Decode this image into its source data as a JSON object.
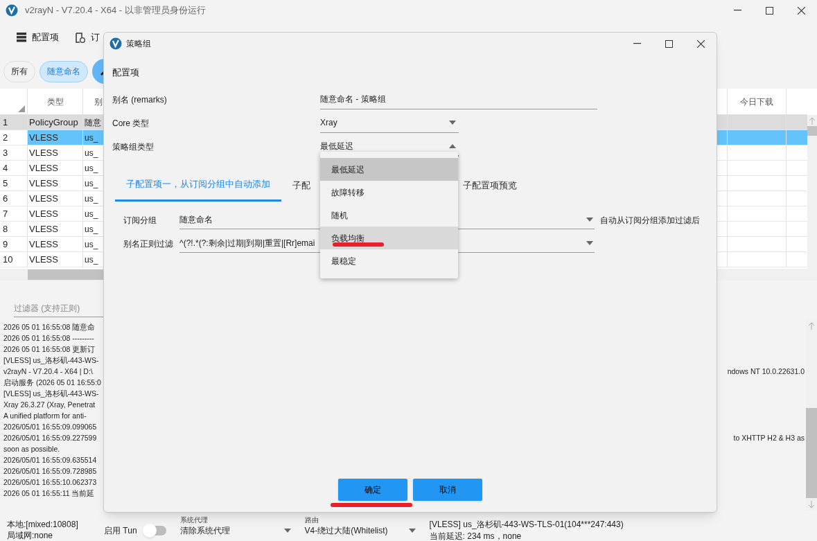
{
  "window": {
    "title": "v2rayN - V7.20.4 - X64 - 以非管理员身份运行"
  },
  "toolbar": [
    {
      "label": "配置项"
    },
    {
      "label": "订"
    }
  ],
  "groups": [
    {
      "label": "所有",
      "selected": false
    },
    {
      "label": "随意命名",
      "selected": true
    }
  ],
  "table": {
    "columns": {
      "type": "类型",
      "name": "别",
      "today_download": "今日下载"
    },
    "rows": [
      {
        "index": "1",
        "type": "PolicyGroup",
        "name": "随意",
        "selected": false,
        "active": true
      },
      {
        "index": "2",
        "type": "VLESS",
        "name": "us_",
        "selected": true,
        "active": false
      },
      {
        "index": "3",
        "type": "VLESS",
        "name": "us_",
        "selected": false,
        "active": false
      },
      {
        "index": "4",
        "type": "VLESS",
        "name": "us_",
        "selected": false,
        "active": false
      },
      {
        "index": "5",
        "type": "VLESS",
        "name": "us_",
        "selected": false,
        "active": false
      },
      {
        "index": "6",
        "type": "VLESS",
        "name": "us_",
        "selected": false,
        "active": false
      },
      {
        "index": "7",
        "type": "VLESS",
        "name": "us_",
        "selected": false,
        "active": false
      },
      {
        "index": "8",
        "type": "VLESS",
        "name": "us_",
        "selected": false,
        "active": false
      },
      {
        "index": "9",
        "type": "VLESS",
        "name": "us_",
        "selected": false,
        "active": false
      },
      {
        "index": "10",
        "type": "VLESS",
        "name": "us_",
        "selected": false,
        "active": false
      }
    ]
  },
  "filter": {
    "placeholder": "过滤器 (支持正则)"
  },
  "log": [
    {
      "text": "2026 05 01 16:55:08 随意命"
    },
    {
      "text": "2026 05 01 16:55:08 ---------"
    },
    {
      "text": "2026 05 01 16:55:08 更新订"
    },
    {
      "text": "[VLESS] us_洛杉矶-443-WS-"
    },
    {
      "text": "v2rayN - V7.20.4 - X64 | D:\\",
      "tail": "ndows NT 10.0.22631.0"
    },
    {
      "text": "启动服务 (2026 05 01 16:55:0"
    },
    {
      "text": "[VLESS] us_洛杉矶-443-WS-"
    },
    {
      "text": "Xray 26.3.27 (Xray, Penetrat"
    },
    {
      "text": "A unified platform for anti-"
    },
    {
      "text": "2026/05/01 16:55:09.099065"
    },
    {
      "text": "2026/05/01 16:55:09.227599",
      "tail": "to XHTTP H2 & H3 as"
    },
    {
      "text": "soon as possible."
    },
    {
      "text": "2026/05/01 16:55:09.635514"
    },
    {
      "text": "2026/05/01 16:55:09.728985"
    },
    {
      "text": "2026/05/01 16:55:10.062373"
    },
    {
      "text": "2026 05 01 16:55:11 当前延"
    }
  ],
  "status_bar": {
    "local": "本地:[mixed:10808]",
    "lan": "局域网:none",
    "tun": {
      "label": "启用 Tun",
      "on": false
    },
    "proxy": {
      "label": "系统代理",
      "value": "清除系统代理"
    },
    "routing": {
      "label": "路由",
      "value": "V4-绕过大陆(Whitelist)"
    },
    "server": "[VLESS] us_洛杉矶-443-WS-TLS-01(104***247:443)",
    "latency": "当前延迟: 234 ms，none"
  },
  "dialog": {
    "title": "策略组",
    "section": "配置项",
    "fields": [
      {
        "kind": "text",
        "label": "别名 (remarks)",
        "value": "随意命名 - 策略组"
      },
      {
        "kind": "select",
        "label": "Core 类型",
        "value": "Xray",
        "open": false
      },
      {
        "kind": "select",
        "label": "策略组类型",
        "value": "最低延迟",
        "open": true
      }
    ],
    "tabs": [
      {
        "label": "子配置项一，从订阅分组中自动添加",
        "selected": true
      },
      {
        "label": "子配",
        "selected": false
      },
      {
        "label": "子配置项预览",
        "selected": false
      }
    ],
    "tab_fields": [
      {
        "label": "订阅分组",
        "value": "随意命名",
        "note": "自动从订阅分组添加过滤后"
      },
      {
        "label": "别名正则过滤",
        "value": "^(?!.*(?:剩余|过期|到期|重置|[Rr]emai"
      }
    ],
    "dropdown": [
      {
        "label": "最低延迟",
        "selected": true,
        "hovered": false
      },
      {
        "label": "故障转移",
        "selected": false,
        "hovered": false
      },
      {
        "label": "随机",
        "selected": false,
        "hovered": false
      },
      {
        "label": "负载均衡",
        "selected": false,
        "hovered": true
      },
      {
        "label": "最稳定",
        "selected": false,
        "hovered": false
      }
    ],
    "buttons": [
      "确定",
      "取消"
    ]
  }
}
